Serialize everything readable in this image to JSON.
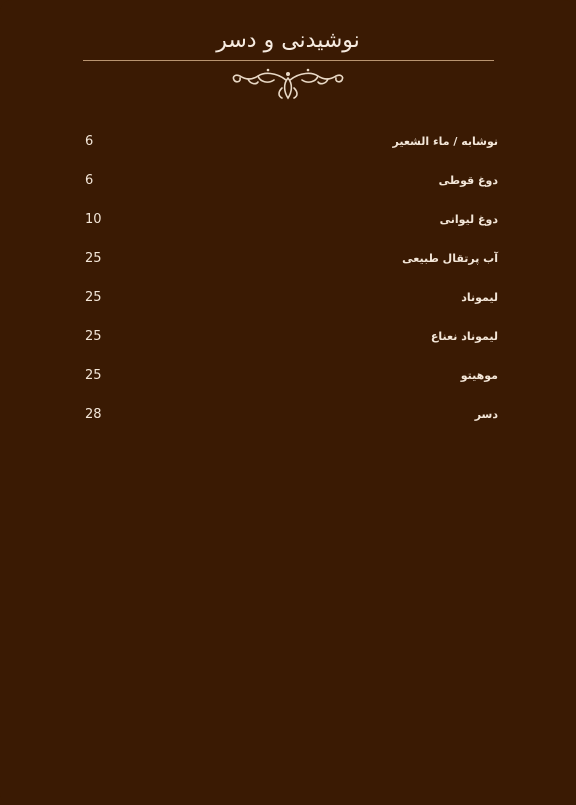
{
  "menu": {
    "title": "نوشیدنی و دسر",
    "items": [
      {
        "name": "نوشابه / ماء الشعير",
        "price": "6"
      },
      {
        "name": "دوغ قوطی",
        "price": "6"
      },
      {
        "name": "دوغ لیوانی",
        "price": "10"
      },
      {
        "name": "آب پرتقال طبیعی",
        "price": "25"
      },
      {
        "name": "لیموناد",
        "price": "25"
      },
      {
        "name": "لیموناد نعناع",
        "price": "25"
      },
      {
        "name": "موهیتو",
        "price": "25"
      },
      {
        "name": "دسر",
        "price": "28"
      }
    ]
  },
  "colors": {
    "background": "#3a1a03",
    "text": "#f3e6d8",
    "rule": "#b89470",
    "ornament": "#e9d9c6"
  },
  "icons": {
    "ornament": "flourish-divider-icon"
  }
}
